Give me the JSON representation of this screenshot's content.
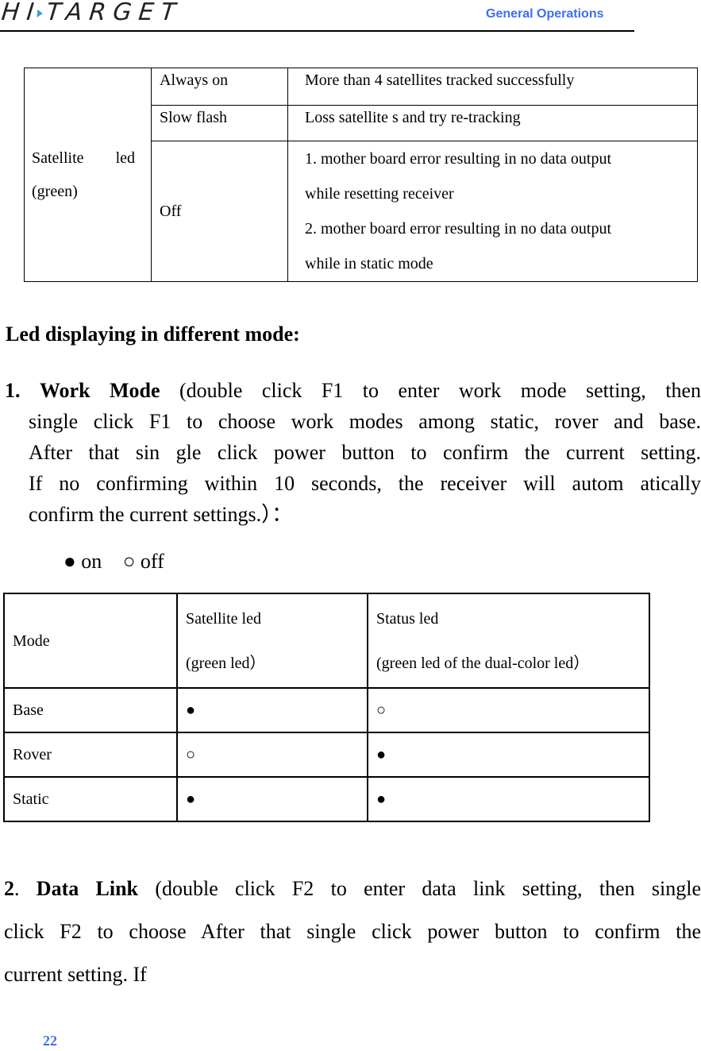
{
  "header": {
    "logo": "HI TARGET",
    "section_title": "General Operations"
  },
  "satellite_table": {
    "label_line1_a": "Satellite",
    "label_line1_b": "led",
    "label_line2": "(green)",
    "rows": [
      {
        "state": "Always on",
        "description": [
          "More than 4 satellites tracked successfully"
        ]
      },
      {
        "state": "Slow flash",
        "description": [
          "Loss satellite s and try re-tracking"
        ]
      },
      {
        "state": "Off",
        "description": [
          "1. mother board error resulting in no data output",
          "while resetting receiver",
          "2. mother board error resulting in no data output",
          "while in static mode"
        ]
      }
    ]
  },
  "led_heading": "Led displaying in different mode:",
  "work_mode": {
    "number": "1.",
    "title": "Work Mode",
    "line1": "(double click F1 to enter work mode setting, then",
    "lines": [
      "single click F1 to choose work modes among static, rover and base.",
      "After that sin gle click power button to confirm the current setting.",
      "If no confirming within 10 seconds, the receiver will autom atically",
      "confirm the current settings.）："
    ]
  },
  "legend": {
    "on": "● on",
    "off": "○ off"
  },
  "mode_table": {
    "headers": {
      "mode": "Mode",
      "sat_line1": "Satellite led",
      "sat_line2": "(green led）",
      "status_line1": "Status led",
      "status_line2": "(green led of the dual-color led）"
    },
    "rows": [
      {
        "mode": "Base",
        "satellite": "●",
        "status": "○"
      },
      {
        "mode": "Rover",
        "satellite": "○",
        "status": "●"
      },
      {
        "mode": "Static",
        "satellite": "●",
        "status": "●"
      }
    ]
  },
  "data_link": {
    "number": "2",
    "title": "Data Link",
    "line1": "(double click F2 to enter data link setting, then single",
    "line2": "click F2 to choose After that single click power button to confirm the",
    "line3": "current setting. If"
  },
  "page_number": "22"
}
